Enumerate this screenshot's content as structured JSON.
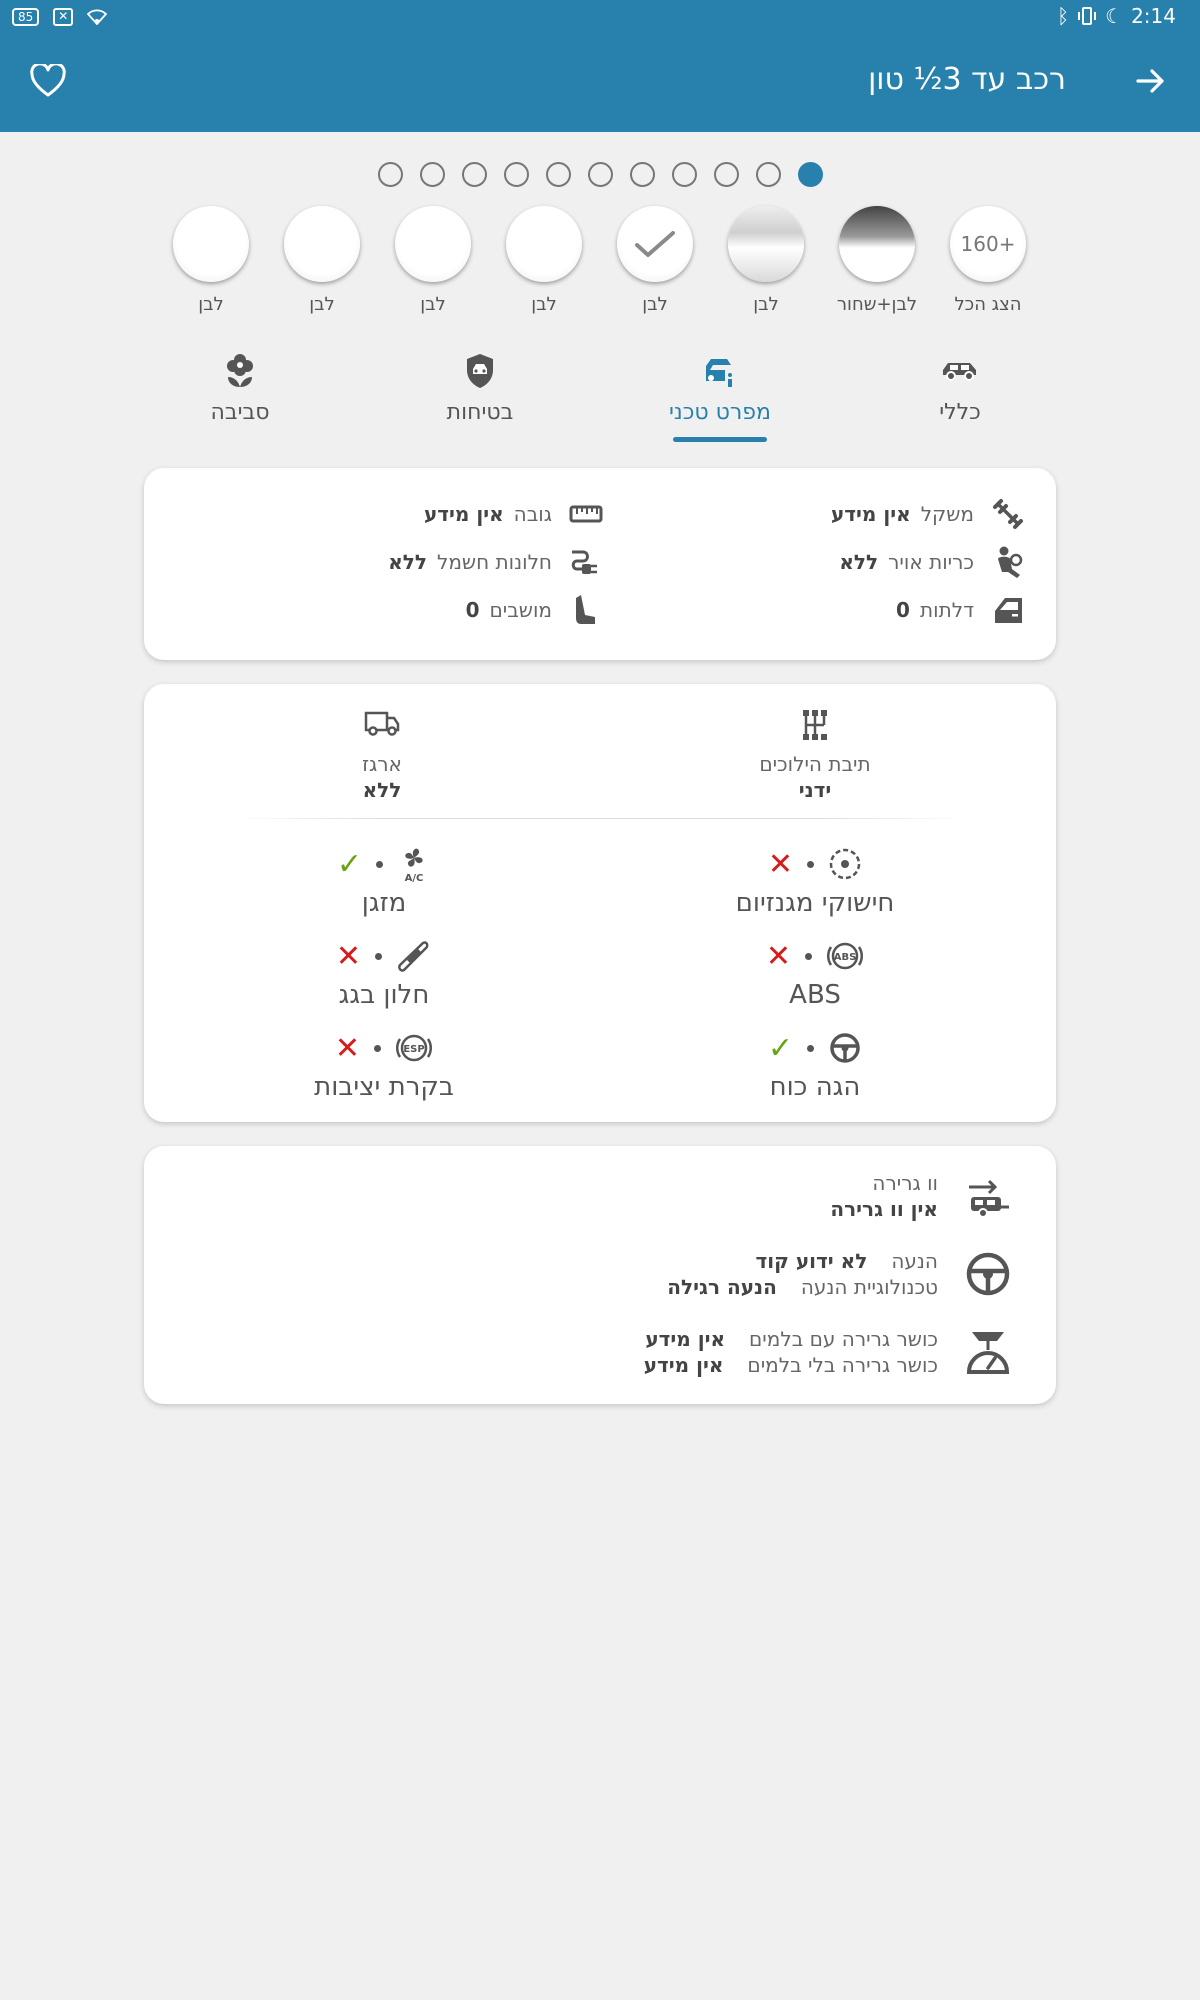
{
  "status_bar": {
    "battery": "85",
    "time": "2:14"
  },
  "app_bar": {
    "title": "רכב עד 3½ טון"
  },
  "pager": {
    "count": 11,
    "active_index": 10
  },
  "swatches": [
    {
      "label": "הצג הכל",
      "text": "160+"
    },
    {
      "label": "לבן+שחור",
      "text": ""
    },
    {
      "label": "לבן",
      "text": ""
    },
    {
      "label": "לבן",
      "text": ""
    },
    {
      "label": "לבן",
      "text": ""
    },
    {
      "label": "לבן",
      "text": ""
    },
    {
      "label": "לבן",
      "text": ""
    },
    {
      "label": "לבן",
      "text": ""
    }
  ],
  "tabs": [
    {
      "label": "כללי",
      "active": false
    },
    {
      "label": "מפרט טכני",
      "active": true
    },
    {
      "label": "בטיחות",
      "active": false
    },
    {
      "label": "סביבה",
      "active": false
    }
  ],
  "specs": {
    "weight": {
      "label": "משקל",
      "value": "אין מידע"
    },
    "height": {
      "label": "גובה",
      "value": "אין מידע"
    },
    "airbags": {
      "label": "כריות אויר",
      "value": "ללא"
    },
    "power_windows": {
      "label": "חלונות חשמל",
      "value": "ללא"
    },
    "doors": {
      "label": "דלתות",
      "value": "0"
    },
    "seats": {
      "label": "מושבים",
      "value": "0"
    }
  },
  "drive": {
    "gearbox": {
      "label": "תיבת הילוכים",
      "value": "ידני"
    },
    "cargo": {
      "label": "ארגז",
      "value": "ללא"
    }
  },
  "features": {
    "magnesium_wheels": {
      "name": "חישוקי מגנזיום",
      "available": false
    },
    "ac": {
      "name": "מזגן",
      "available": true
    },
    "abs": {
      "name": "ABS",
      "available": false
    },
    "sunroof": {
      "name": "חלון בגג",
      "available": false
    },
    "power_steering": {
      "name": "הגה כוח",
      "available": true
    },
    "stability": {
      "name": "בקרת יציבות",
      "available": false
    },
    "yes_mark": "✓",
    "no_mark": "✕"
  },
  "extra": {
    "tow_hook": {
      "label": "וו גרירה",
      "value": "אין וו גרירה"
    },
    "propulsion": {
      "label": "הנעה",
      "value": "לא ידוע קוד",
      "tech_label": "טכנולוגיית הנעה",
      "tech_value": "הנעה רגילה"
    },
    "towing": {
      "braked_label": "כושר גרירה עם בלמים",
      "braked_value": "אין מידע",
      "unbraked_label": "כושר גרירה בלי בלמים",
      "unbraked_value": "אין מידע"
    }
  }
}
